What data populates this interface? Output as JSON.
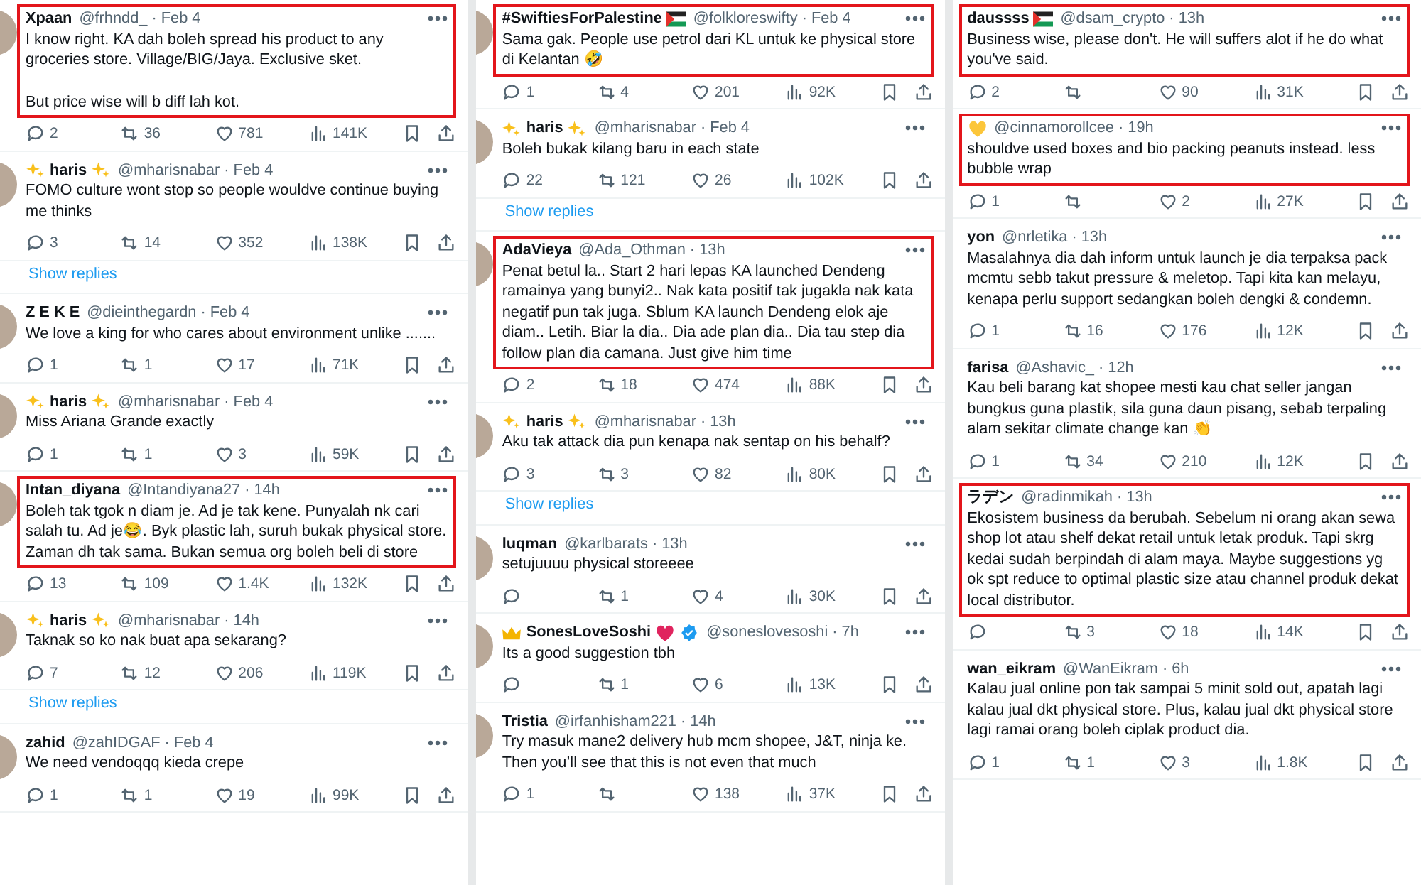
{
  "columns": [
    {
      "tweets": [
        {
          "avatar": true,
          "highlighted": true,
          "name": "Xpaan",
          "meta": "@frhndd_ · Feb 4",
          "text": [
            "I know right. KA dah boleh spread his product to any groceries store. Village/BIG/Jaya. Exclusive sket.",
            "But price wise will b diff lah kot."
          ],
          "stats": {
            "replies": "2",
            "retweets": "36",
            "likes": "781",
            "views": "141K"
          }
        },
        {
          "avatar": true,
          "highlighted": false,
          "badges_before": [
            {
              "kind": "sparkle"
            }
          ],
          "name": "haris",
          "badges_after": [
            {
              "kind": "sparkle"
            }
          ],
          "meta": "@mharisnabar · Feb 4",
          "text": [
            "FOMO culture wont stop so people wouldve continue buying me thinks"
          ],
          "stats": {
            "replies": "3",
            "retweets": "14",
            "likes": "352",
            "views": "138K"
          },
          "show_replies": "Show replies"
        },
        {
          "avatar": true,
          "highlighted": false,
          "name": "Z E K E",
          "meta": "@dieinthegardn · Feb 4",
          "text": [
            "We love a king for who cares about environment unlike ......."
          ],
          "stats": {
            "replies": "1",
            "retweets": "1",
            "likes": "17",
            "views": "71K"
          }
        },
        {
          "avatar": true,
          "highlighted": false,
          "badges_before": [
            {
              "kind": "sparkle"
            }
          ],
          "name": "haris",
          "badges_after": [
            {
              "kind": "sparkle"
            }
          ],
          "meta": "@mharisnabar · Feb 4",
          "text": [
            "Miss Ariana Grande exactly"
          ],
          "stats": {
            "replies": "1",
            "retweets": "1",
            "likes": "3",
            "views": "59K"
          }
        },
        {
          "avatar": true,
          "highlighted": true,
          "name": "Intan_diyana",
          "meta": "@Intandiyana27 · 14h",
          "text": [
            "Boleh tak tgok n diam je. Ad je tak kene. Punyalah nk cari salah tu. Ad je😂. Byk plastic lah, suruh bukak physical store. Zaman dh tak sama. Bukan semua org boleh beli di store"
          ],
          "stats": {
            "replies": "13",
            "retweets": "109",
            "likes": "1.4K",
            "views": "132K"
          }
        },
        {
          "avatar": true,
          "highlighted": false,
          "badges_before": [
            {
              "kind": "sparkle"
            }
          ],
          "name": "haris",
          "badges_after": [
            {
              "kind": "sparkle"
            }
          ],
          "meta": "@mharisnabar · 14h",
          "text": [
            "Taknak so ko nak buat apa sekarang?"
          ],
          "stats": {
            "replies": "7",
            "retweets": "12",
            "likes": "206",
            "views": "119K"
          },
          "show_replies": "Show replies"
        },
        {
          "avatar": true,
          "highlighted": false,
          "name": "zahid",
          "meta": "@zahIDGAF · Feb 4",
          "text": [
            "We need vendoqqq kieda crepe"
          ],
          "stats": {
            "replies": "1",
            "retweets": "1",
            "likes": "19",
            "views": "99K"
          }
        }
      ]
    },
    {
      "tweets": [
        {
          "avatar": true,
          "highlighted": true,
          "name": "#SwiftiesForPalestine",
          "badges_after": [
            {
              "kind": "flag"
            }
          ],
          "meta": "@folkloreswifty · Feb 4",
          "text": [
            "Sama gak. People use petrol dari KL untuk ke physical store di Kelantan 🤣"
          ],
          "stats": {
            "replies": "1",
            "retweets": "4",
            "likes": "201",
            "views": "92K"
          }
        },
        {
          "avatar": true,
          "highlighted": false,
          "badges_before": [
            {
              "kind": "sparkle"
            }
          ],
          "name": "haris",
          "badges_after": [
            {
              "kind": "sparkle"
            }
          ],
          "meta": "@mharisnabar · Feb 4",
          "text": [
            "Boleh bukak kilang baru in each state"
          ],
          "stats": {
            "replies": "22",
            "retweets": "121",
            "likes": "26",
            "views": "102K"
          },
          "show_replies": "Show replies"
        },
        {
          "avatar": true,
          "highlighted": true,
          "name": "AdaVieya",
          "meta": "@Ada_Othman · 13h",
          "text": [
            "Penat betul la.. Start 2 hari lepas KA launched Dendeng ramainya yang bunyi2.. Nak kata positif tak jugakla nak kata negatif pun tak juga. Sblum KA launch Dendeng elok aje diam.. Letih. Biar la dia.. Dia ade plan dia.. Dia tau step dia follow plan dia camana. Just give him time"
          ],
          "stats": {
            "replies": "2",
            "retweets": "18",
            "likes": "474",
            "views": "88K"
          }
        },
        {
          "avatar": true,
          "highlighted": false,
          "badges_before": [
            {
              "kind": "sparkle"
            }
          ],
          "name": "haris",
          "badges_after": [
            {
              "kind": "sparkle"
            }
          ],
          "meta": "@mharisnabar · 13h",
          "text": [
            "Aku tak attack dia pun kenapa nak sentap on his behalf?"
          ],
          "stats": {
            "replies": "3",
            "retweets": "3",
            "likes": "82",
            "views": "80K"
          },
          "show_replies": "Show replies"
        },
        {
          "avatar": true,
          "highlighted": false,
          "name": "luqman",
          "meta": "@karlbarats · 13h",
          "text": [
            "setujuuuu physical storeeee"
          ],
          "stats": {
            "retweets": "1",
            "likes": "4",
            "views": "30K"
          }
        },
        {
          "avatar": true,
          "highlighted": false,
          "badges_before": [
            {
              "kind": "crown"
            }
          ],
          "name": "SonesLoveSoshi",
          "badges_after": [
            {
              "kind": "red-heart"
            },
            {
              "kind": "verified"
            }
          ],
          "meta": "@soneslovesoshi · 7h",
          "text": [
            "Its a good suggestion tbh"
          ],
          "stats": {
            "retweets": "1",
            "likes": "6",
            "views": "13K"
          }
        },
        {
          "avatar": true,
          "highlighted": false,
          "name": "Tristia",
          "meta": "@irfanhisham221 · 14h",
          "text": [
            "Try masuk mane2 delivery hub mcm shopee, J&T, ninja ke. Then you’ll see that this is not even that much"
          ],
          "stats": {
            "replies": "1",
            "likes": "138",
            "views": "37K"
          }
        }
      ]
    },
    {
      "tweets": [
        {
          "highlighted": true,
          "name": "daussss",
          "badges_after": [
            {
              "kind": "flag"
            }
          ],
          "meta": "@dsam_crypto · 13h",
          "text": [
            "Business wise, please don't. He will suffers alot if he do what you've said."
          ],
          "stats": {
            "replies": "2",
            "likes": "90",
            "views": "31K"
          }
        },
        {
          "highlighted": true,
          "badges_before": [
            {
              "kind": "yellow-heart"
            }
          ],
          "meta": "@cinnamorollcee · 19h",
          "text": [
            "shouldve used boxes and bio packing peanuts instead. less bubble wrap"
          ],
          "stats": {
            "replies": "1",
            "likes": "2",
            "views": "27K"
          }
        },
        {
          "highlighted": false,
          "name": "yon",
          "meta": "@nrletika · 13h",
          "text": [
            "Masalahnya dia dah inform untuk launch je dia terpaksa pack mcmtu sebb takut pressure & meletop. Tapi kita kan melayu, kenapa perlu support sedangkan boleh dengki & condemn."
          ],
          "stats": {
            "replies": "1",
            "retweets": "16",
            "likes": "176",
            "views": "12K"
          }
        },
        {
          "highlighted": false,
          "name": "farisa",
          "meta": "@Ashavic_ · 12h",
          "text": [
            "Kau beli barang kat shopee mesti kau chat seller jangan bungkus guna plastik, sila guna daun pisang, sebab terpaling alam sekitar climate change kan 👏"
          ],
          "stats": {
            "replies": "1",
            "retweets": "34",
            "likes": "210",
            "views": "12K"
          }
        },
        {
          "highlighted": true,
          "name": "ラデン",
          "meta": "@radinmikah · 13h",
          "text": [
            "Ekosistem business da berubah. Sebelum ni orang akan sewa shop lot atau shelf dekat retail untuk letak produk. Tapi skrg kedai sudah berpindah di alam maya. Maybe suggestions yg ok spt reduce to optimal plastic size atau channel produk dekat local distributor."
          ],
          "stats": {
            "retweets": "3",
            "likes": "18",
            "views": "14K"
          }
        },
        {
          "highlighted": false,
          "name": "wan_eikram",
          "meta": "@WanEikram · 6h",
          "text": [
            "Kalau jual online pon tak sampai 5 minit sold out, apatah lagi kalau jual dkt physical store. Plus, kalau jual dkt physical store lagi ramai orang boleh ciplak product dia."
          ],
          "stats": {
            "replies": "1",
            "retweets": "1",
            "likes": "3",
            "views": "1.8K"
          }
        }
      ]
    }
  ]
}
